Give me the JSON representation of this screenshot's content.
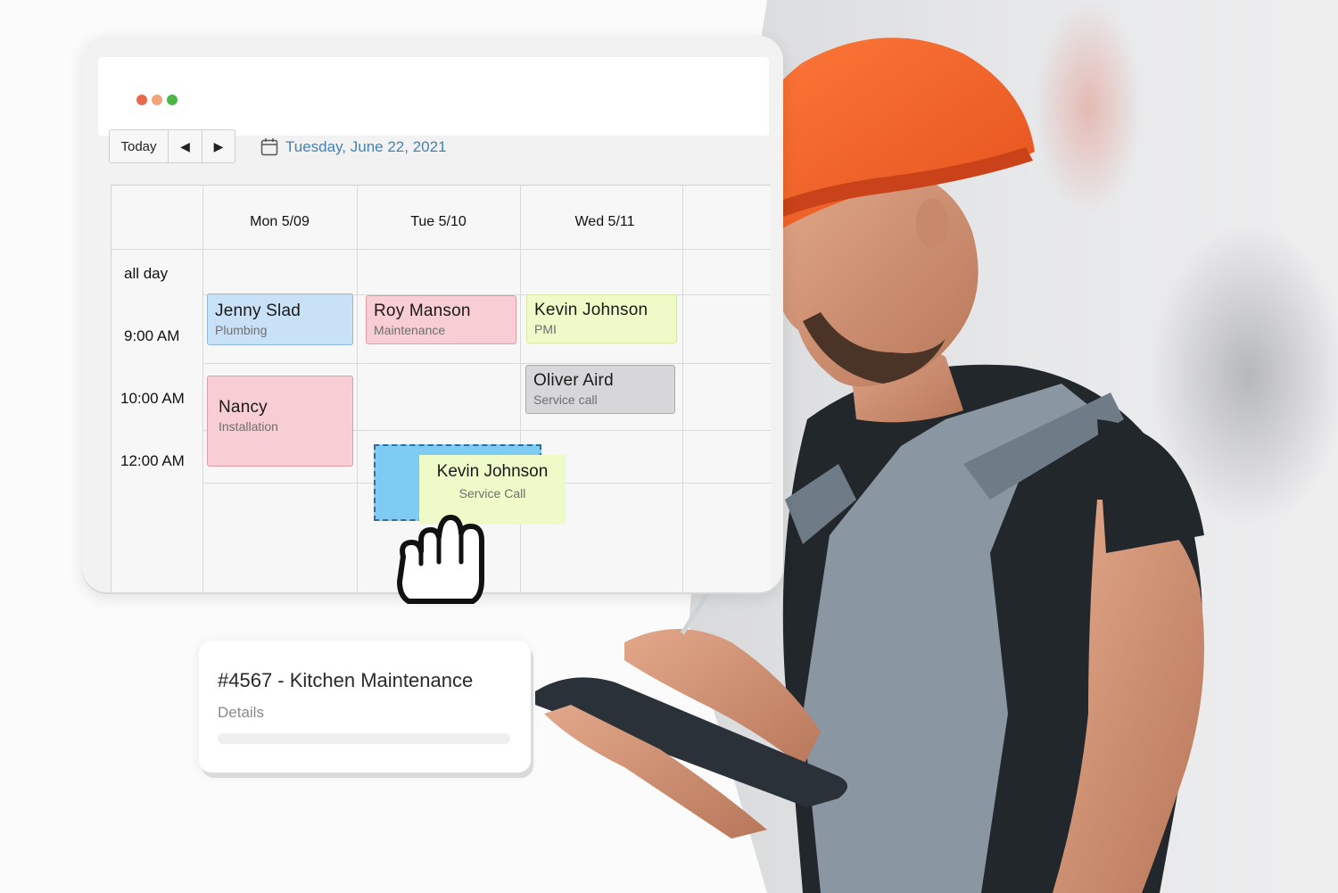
{
  "colors": {
    "dot_red": "#e96a4a",
    "dot_orange": "#f0a57a",
    "dot_green": "#4cb84a",
    "accent_date": "#3f84b4",
    "event_blue": "#c9e1f7",
    "event_pink": "#f8cdd3",
    "event_yellow": "#eefbc8",
    "event_gray": "#d7d7d9",
    "drop_target": "#7ecbf4"
  },
  "toolbar": {
    "today_label": "Today",
    "prev_icon": "◀",
    "next_icon": "▶"
  },
  "date": {
    "label": "Tuesday, June 22, 2021",
    "icon": "calendar-icon"
  },
  "calendar": {
    "columns": [
      "Mon 5/09",
      "Tue 5/10",
      "Wed 5/11"
    ],
    "rows": {
      "all_day": "all day",
      "t1": "9:00 AM",
      "t2": "10:00 AM",
      "t3": "12:00 AM"
    },
    "events": {
      "jenny": {
        "name": "Jenny Slad",
        "type": "Plumbing"
      },
      "roy": {
        "name": "Roy Manson",
        "type": "Maintenance"
      },
      "kevin": {
        "name": "Kevin Johnson",
        "type": "PMI"
      },
      "oliver": {
        "name": "Oliver Aird",
        "type": "Service call"
      },
      "nancy": {
        "name": "Nancy",
        "type": "Installation"
      },
      "kevin_drag": {
        "name": "Kevin Johnson",
        "type": "Service Call"
      }
    }
  },
  "job_card": {
    "title": "#4567 - Kitchen Maintenance",
    "details": "Details"
  }
}
